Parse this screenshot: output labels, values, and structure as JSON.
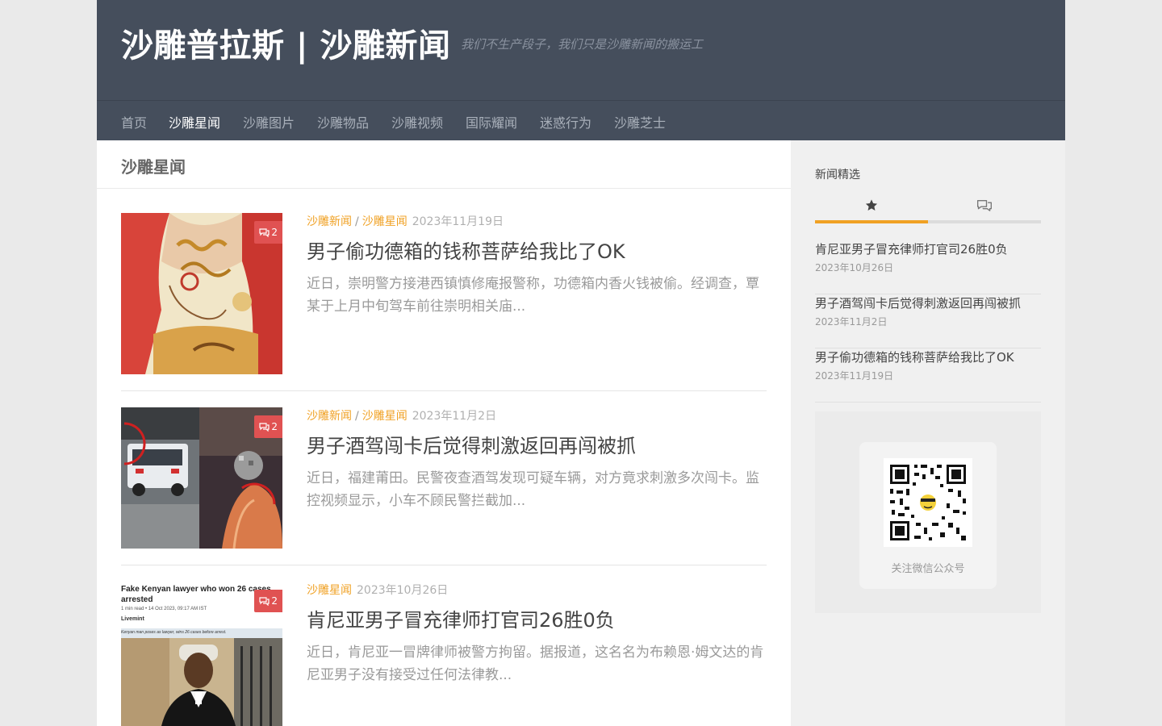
{
  "header": {
    "site_title": "沙雕普拉斯 | 沙雕新闻",
    "tagline": "我们不生产段子，我们只是沙雕新闻的搬运工"
  },
  "nav": {
    "items": [
      "首页",
      "沙雕星闻",
      "沙雕图片",
      "沙雕物品",
      "沙雕视频",
      "国际耀闻",
      "迷惑行为",
      "沙雕芝士"
    ],
    "active": "沙雕星闻"
  },
  "main": {
    "page_title": "沙雕星闻",
    "posts": [
      {
        "categories": [
          "沙雕新闻",
          "沙雕星闻"
        ],
        "date": "2023年11月19日",
        "title": "男子偷功德箱的钱称菩萨给我比了OK",
        "excerpt": "近日，崇明警方接港西镇慎修庵报警称，功德箱内香火钱被偷。经调查，覃某于上月中旬驾车前往崇明相关庙...",
        "comments": "2"
      },
      {
        "categories": [
          "沙雕新闻",
          "沙雕星闻"
        ],
        "date": "2023年11月2日",
        "title": "男子酒驾闯卡后觉得刺激返回再闯被抓",
        "excerpt": "近日，福建莆田。民警夜查酒驾发现可疑车辆，对方竟求刺激多次闯卡。监控视频显示，小车不顾民警拦截加...",
        "comments": "2"
      },
      {
        "categories": [
          "沙雕星闻"
        ],
        "date": "2023年10月26日",
        "title": "肯尼亚男子冒充律师打官司26胜0负",
        "excerpt": "近日，肯尼亚一冒牌律师被警方拘留。据报道，这名名为布赖恩·姆文达的肯尼亚男子没有接受过任何法律教...",
        "comments": "2",
        "thumb_text": {
          "headline_1": "Fake Kenyan lawyer who won 26 cases",
          "headline_2": "arrested",
          "readtime": "1 min read",
          "byline": "• 14 Oct 2023, 09:17 AM IST",
          "source": "Livemint",
          "caption": "Kenyan man poses as lawyer, wins 26 cases before arrest."
        }
      }
    ]
  },
  "sidebar": {
    "widget_title": "新闻精选",
    "tabs": [
      {
        "icon": "star-icon",
        "active": true
      },
      {
        "icon": "comments-icon",
        "active": false
      }
    ],
    "items": [
      {
        "title": "肯尼亚男子冒充律师打官司26胜0负",
        "date": "2023年10月26日"
      },
      {
        "title": "男子酒驾闯卡后觉得刺激返回再闯被抓",
        "date": "2023年11月2日"
      },
      {
        "title": "男子偷功德箱的钱称菩萨给我比了OK",
        "date": "2023年11月19日"
      }
    ],
    "qr_label": "关注微信公众号"
  },
  "colors": {
    "header_bg": "#454e5c",
    "accent": "#f0a124",
    "badge": "#e05252"
  }
}
